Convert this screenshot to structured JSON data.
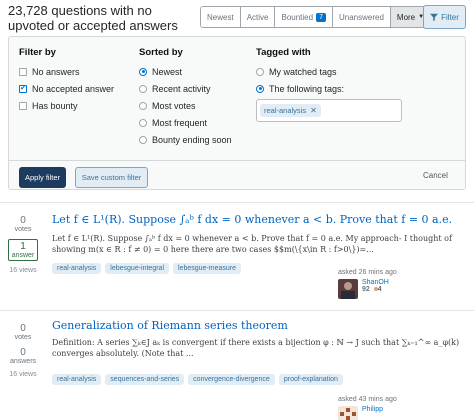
{
  "header": {
    "count_text": "23,728 questions with no upvoted or accepted answers",
    "tabs": [
      {
        "label": "Newest"
      },
      {
        "label": "Active"
      },
      {
        "label": "Bountied",
        "badge": "7"
      },
      {
        "label": "Unanswered"
      },
      {
        "label": "More"
      }
    ],
    "filter_label": "Filter"
  },
  "filter_panel": {
    "filter_by": {
      "heading": "Filter by",
      "options": [
        {
          "label": "No answers",
          "checked": false
        },
        {
          "label": "No accepted answer",
          "checked": true
        },
        {
          "label": "Has bounty",
          "checked": false
        }
      ]
    },
    "sorted_by": {
      "heading": "Sorted by",
      "options": [
        {
          "label": "Newest",
          "selected": true
        },
        {
          "label": "Recent activity",
          "selected": false
        },
        {
          "label": "Most votes",
          "selected": false
        },
        {
          "label": "Most frequent",
          "selected": false
        },
        {
          "label": "Bounty ending soon",
          "selected": false
        }
      ]
    },
    "tagged_with": {
      "heading": "Tagged with",
      "options": [
        {
          "label": "My watched tags",
          "selected": false
        },
        {
          "label": "The following tags:",
          "selected": true
        }
      ],
      "tags": [
        "real-analysis"
      ]
    },
    "apply_label": "Apply filter",
    "save_label": "Save custom filter",
    "cancel_label": "Cancel"
  },
  "questions": [
    {
      "votes": "0",
      "votes_label": "votes",
      "answers": "1",
      "answers_label": "answer",
      "views": "16 views",
      "title": "Let f ∈ L¹(R). Suppose ∫ₐᵇ f dx = 0 whenever a < b. Prove that f = 0 a.e.",
      "excerpt": "Let f ∈ L¹(R). Suppose ∫ₐᵇ f dx = 0 whenever a < b. Prove that f = 0 a.e. My approach- I thought of showing m(x ∈ R : f ≠ 0) = 0 here there are two cases $$m(\\{x\\in R : f>0\\})=...",
      "tags": [
        "real-analysis",
        "lebesgue-integral",
        "lebesgue-measure"
      ],
      "asked": "asked 26 mins ago",
      "user": "ShanOH",
      "reputation": "92",
      "bronze": "4"
    },
    {
      "votes": "0",
      "votes_label": "votes",
      "answers": "0",
      "answers_label": "answers",
      "views": "16 views",
      "title": "Generalization of Riemann series theorem",
      "excerpt": "Definition: A series ∑ₖ∈J aₖ is convergent if there exists a bijection φ : ℕ → J such that ∑ₖ₌₁^∞ a_φ(k) converges absolutely. (Note that ...",
      "tags": [
        "real-analysis",
        "sequences-and-series",
        "convergence-divergence",
        "proof-explanation"
      ],
      "asked": "asked 43 mins ago",
      "user": "Philipp",
      "reputation": "",
      "bronze": ""
    }
  ],
  "colors": {
    "link": "#0063bf",
    "accent": "#0074cc",
    "accepted_green": "#2f6f44",
    "tag_bg": "#e1ecf4",
    "tag_text": "#39739d"
  }
}
